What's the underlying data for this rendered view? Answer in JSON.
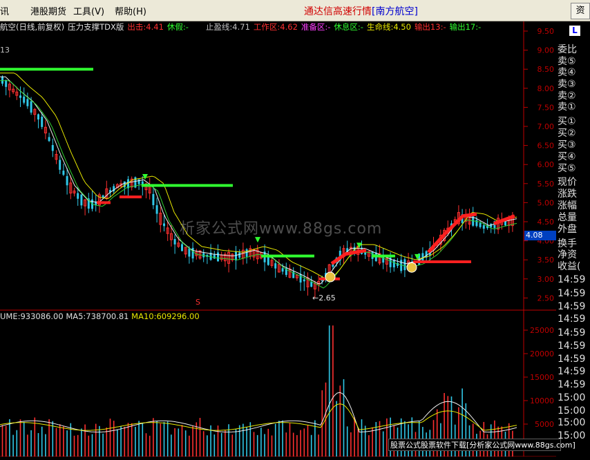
{
  "menu": {
    "items": [
      "讯",
      "港股期货",
      "工具(V)",
      "帮助(H)"
    ],
    "title_prefix": "通达信高速行情",
    "title_stock": "[南方航空]",
    "corner": "资"
  },
  "info": {
    "stock_label": "航空(日线,前复权)",
    "indicator": "压力支撑TDX版",
    "exit_label": "出击:4.41",
    "rest_label": "休假:-",
    "stop_label": "止盈线:4.71",
    "work_label": "工作区:4.62",
    "prep_label": "准备区:-",
    "rest_zone_label": "休息区:-",
    "life_label": "生命线:4.50",
    "out13_label": "输出13:-",
    "out17_label": "输出17:-",
    "left_top_value": "13",
    "low_marker": "←2.65",
    "current_price": "4.08",
    "watermark": "析家公式网www.88gs.com",
    "sell_marker": "S"
  },
  "volume": {
    "vol_label": "UME:933086.00",
    "ma5_label": "MA5:738700.81",
    "ma10_label": "MA10:609296.00"
  },
  "right_panel": {
    "items": [
      "委比",
      "卖⑤",
      "卖④",
      "卖③",
      "卖②",
      "卖①",
      "买①",
      "买②",
      "买③",
      "买④",
      "买⑤",
      "现价",
      "涨跌",
      "涨幅",
      "总量",
      "外盘",
      "换手",
      "净资",
      "收益(",
      "14:59",
      "14:59",
      "14:59",
      "14:59",
      "14:59",
      "14:59",
      "14:59",
      "14:59",
      "14:59",
      "15:00",
      "15:00",
      "15:00",
      "15:00"
    ]
  },
  "price_axis": [
    "9.50",
    "9.00",
    "8.50",
    "8.00",
    "7.50",
    "7.00",
    "6.50",
    "6.00",
    "5.50",
    "5.00",
    "4.50",
    "4.00",
    "3.50",
    "3.00",
    "2.50"
  ],
  "volume_axis": [
    "25000",
    "20000",
    "15000",
    "10000",
    "5000"
  ],
  "footer": "股票公式股票软件下载[分析家公式网www.88gs.com]",
  "colors": {
    "up": "#ff3030",
    "down": "#30c8e8",
    "ma_white": "#f0f0f0",
    "ma_yellow": "#e8e800",
    "ma_green": "#30d030",
    "signal_green": "#30ff30",
    "signal_red": "#ff2020"
  }
}
